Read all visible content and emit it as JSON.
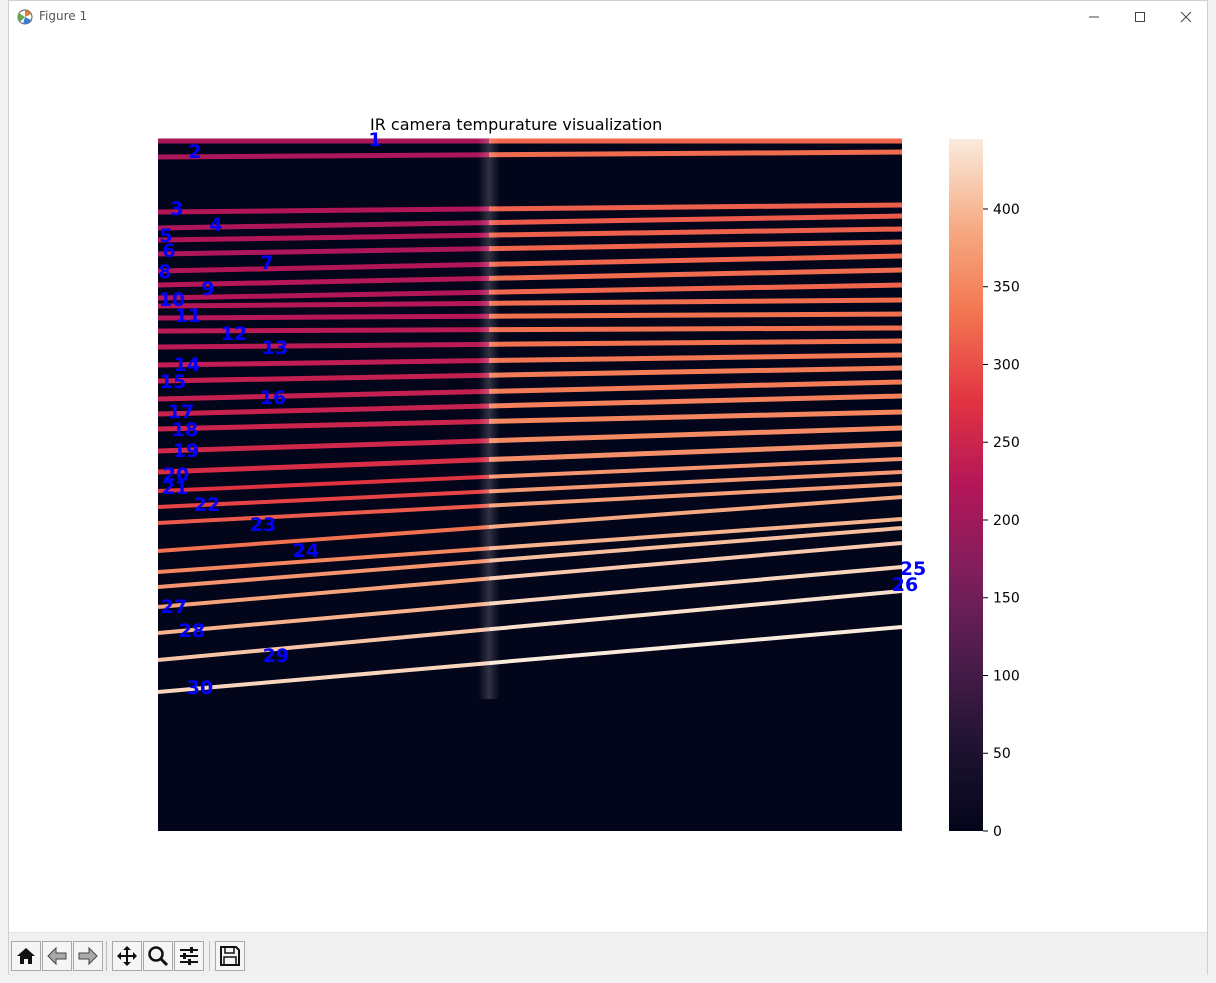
{
  "window": {
    "title": "Figure 1",
    "icon": "matplotlib-icon"
  },
  "toolbar": {
    "buttons": [
      {
        "name": "home-button",
        "icon": "home-icon"
      },
      {
        "name": "back-button",
        "icon": "arrow-left-icon"
      },
      {
        "name": "forward-button",
        "icon": "arrow-right-icon"
      },
      {
        "name": "pan-button",
        "icon": "move-icon"
      },
      {
        "name": "zoom-button",
        "icon": "magnifier-icon"
      },
      {
        "name": "configure-subplots-button",
        "icon": "sliders-icon"
      },
      {
        "name": "save-button",
        "icon": "floppy-disk-icon"
      }
    ]
  },
  "chart_data": {
    "type": "heatmap",
    "title": "IR camera tempurature visualization",
    "colormap": "rocket",
    "colorbar": {
      "ticks": [
        0,
        50,
        100,
        150,
        200,
        250,
        300,
        350,
        400
      ],
      "range": [
        0,
        445
      ]
    },
    "background_value": 0,
    "lines": [
      {
        "label": "1",
        "value_left": 210,
        "value_right": 320
      },
      {
        "label": "2",
        "value_left": 215,
        "value_right": 325
      },
      {
        "label": "3",
        "value_left": 220,
        "value_right": 315
      },
      {
        "label": "4",
        "value_left": 215,
        "value_right": 310
      },
      {
        "label": "5",
        "value_left": 220,
        "value_right": 315
      },
      {
        "label": "6",
        "value_left": 215,
        "value_right": 320
      },
      {
        "label": "7",
        "value_left": 220,
        "value_right": 320
      },
      {
        "label": "8",
        "value_left": 225,
        "value_right": 325
      },
      {
        "label": "9",
        "value_left": 220,
        "value_right": 320
      },
      {
        "label": "10",
        "value_left": 225,
        "value_right": 325
      },
      {
        "label": "11",
        "value_left": 225,
        "value_right": 330
      },
      {
        "label": "12",
        "value_left": 230,
        "value_right": 330
      },
      {
        "label": "13",
        "value_left": 230,
        "value_right": 330
      },
      {
        "label": "14",
        "value_left": 235,
        "value_right": 335
      },
      {
        "label": "15",
        "value_left": 240,
        "value_right": 340
      },
      {
        "label": "16",
        "value_left": 240,
        "value_right": 340
      },
      {
        "label": "17",
        "value_left": 245,
        "value_right": 345
      },
      {
        "label": "18",
        "value_left": 250,
        "value_right": 350
      },
      {
        "label": "19",
        "value_left": 255,
        "value_right": 355
      },
      {
        "label": "20",
        "value_left": 265,
        "value_right": 360
      },
      {
        "label": "21",
        "value_left": 275,
        "value_right": 365
      },
      {
        "label": "22",
        "value_left": 290,
        "value_right": 370
      },
      {
        "label": "23",
        "value_left": 310,
        "value_right": 375
      },
      {
        "label": "24",
        "value_left": 330,
        "value_right": 385
      },
      {
        "label": "25",
        "value_left": 350,
        "value_right": 395
      },
      {
        "label": "26",
        "value_left": 365,
        "value_right": 405
      },
      {
        "label": "27",
        "value_left": 380,
        "value_right": 415
      },
      {
        "label": "28",
        "value_left": 395,
        "value_right": 425
      },
      {
        "label": "29",
        "value_left": 410,
        "value_right": 435
      },
      {
        "label": "30",
        "value_left": 425,
        "value_right": 445
      }
    ]
  }
}
